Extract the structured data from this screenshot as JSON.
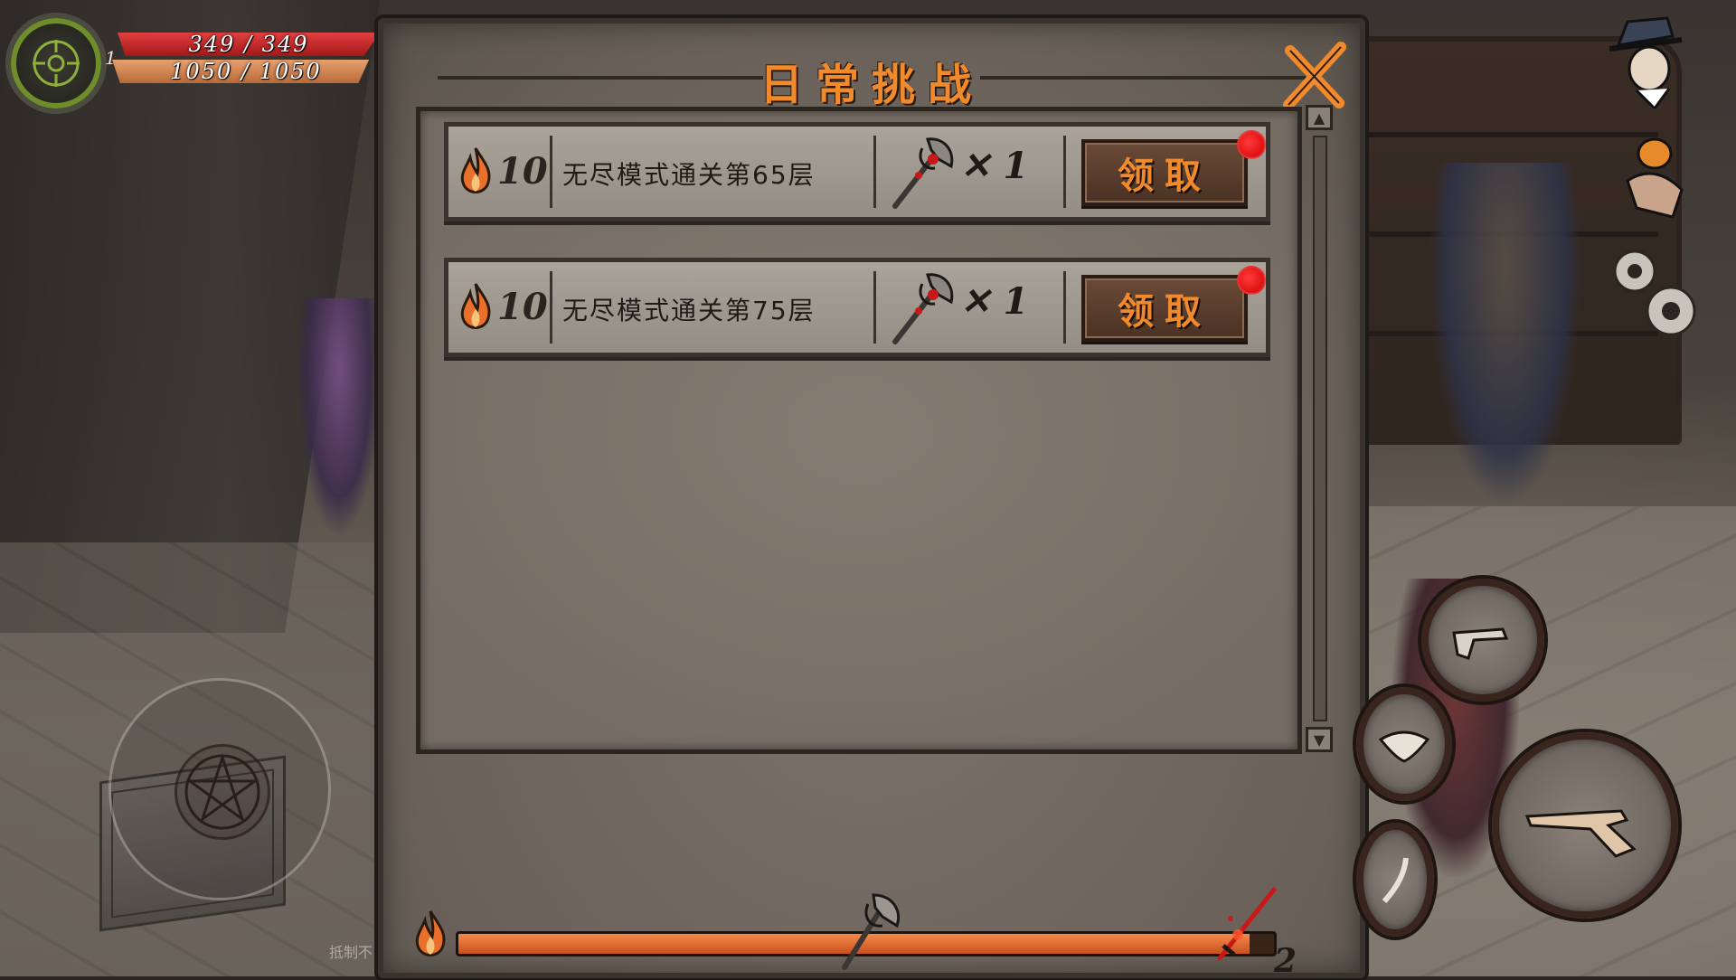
{
  "hud": {
    "level": "1",
    "hp_text": "349 / 349",
    "mp_text": "1050 / 1050"
  },
  "dialog": {
    "title": "日常挑战",
    "tasks": [
      {
        "points": "10",
        "description": "无尽模式通关第65层",
        "reward_qty": "✕ 1",
        "claim_label": "领取"
      },
      {
        "points": "10",
        "description": "无尽模式通关第75层",
        "reward_qty": "✕ 1",
        "claim_label": "领取"
      }
    ],
    "progress": {
      "fraction": 0.97,
      "count": "2"
    }
  },
  "footer": {
    "watermark": "抵制不"
  },
  "colors": {
    "accent_orange": "#f08a2c",
    "hp_red": "#c82828",
    "mp_orange": "#d88850",
    "notify_red": "#e00000"
  }
}
